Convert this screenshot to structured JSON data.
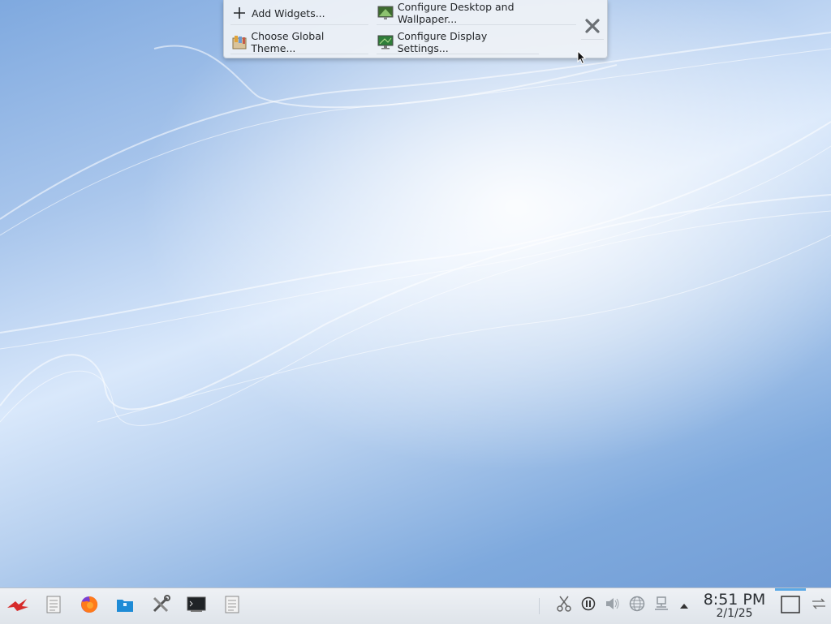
{
  "toolbox": {
    "add_widgets": "Add Widgets...",
    "configure_desktop": "Configure Desktop and Wallpaper...",
    "choose_theme": "Choose Global Theme...",
    "configure_display": "Configure Display Settings...",
    "close_icon": "close-icon"
  },
  "taskbar": {
    "launchers": [
      "app-launcher-icon",
      "text-editor-icon",
      "firefox-icon",
      "file-manager-icon",
      "system-settings-icon",
      "terminal-icon",
      "document-icon"
    ],
    "tray": [
      "clipboard-icon",
      "media-pause-icon",
      "volume-icon",
      "globe-icon",
      "network-icon",
      "expand-tray-icon"
    ],
    "clock_time": "8:51 PM",
    "clock_date": "2/1/25"
  },
  "colors": {
    "panel": "#eef1f5",
    "accent": "#5aa9e6"
  }
}
